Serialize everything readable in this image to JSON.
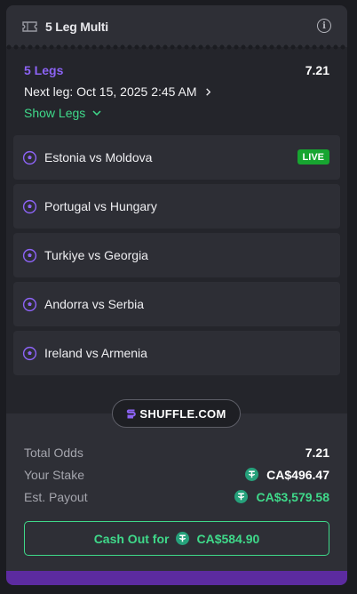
{
  "header": {
    "title": "5 Leg Multi",
    "info_glyph": "i"
  },
  "summary": {
    "legs_count": "5 Legs",
    "odds": "7.21",
    "next_leg": "Next leg: Oct 15, 2025 2:45 AM",
    "show_legs": "Show Legs"
  },
  "legs": [
    {
      "match": "Estonia vs Moldova",
      "badge": "LIVE"
    },
    {
      "match": "Portugal vs Hungary"
    },
    {
      "match": "Turkiye vs Georgia"
    },
    {
      "match": "Andorra vs Serbia"
    },
    {
      "match": "Ireland vs Armenia"
    }
  ],
  "brand": {
    "name": "SHUFFLE.COM"
  },
  "stats": {
    "total_odds_label": "Total Odds",
    "total_odds_value": "7.21",
    "stake_label": "Your Stake",
    "stake_value": "CA$496.47",
    "payout_label": "Est. Payout",
    "payout_value": "CA$3,579.58"
  },
  "cashout": {
    "label": "Cash Out for",
    "amount": "CA$584.90"
  },
  "colors": {
    "accent_purple": "#8c63f5",
    "accent_green": "#3fd98a",
    "live_green": "#17a530",
    "tether": "#26a17b"
  }
}
